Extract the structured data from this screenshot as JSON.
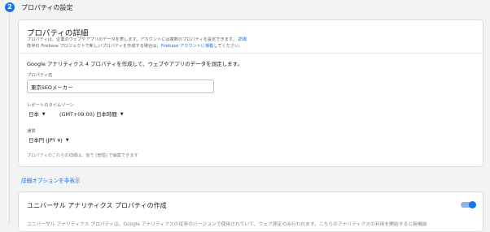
{
  "step": {
    "number": "2",
    "title": "プロパティの設定"
  },
  "details": {
    "title": "プロパティの詳細",
    "desc_line1": "プロパティは、企業のウェブやアプリのデータを表します。アカウントには複数のプロパティを設定できます。",
    "desc_line1_link": "詳細",
    "desc_line2_a": "既存の Firebase プロジェクトで新しいプロパティを作成する場合は、",
    "desc_line2_b": "Firebase アカウントに移動",
    "desc_line2_c": "してください。",
    "instruction": "Google アナリティクス 4 プロパティを作成して、ウェブやアプリのデータを測定します。",
    "name_label": "プロパティ名",
    "name_value": "東京SEOメーカー",
    "timezone_label": "レポートのタイムゾーン",
    "country": "日本",
    "timezone": "(GMT+09:00) 日本時間",
    "currency_label": "通貨",
    "currency": "日本円 (JPY ¥)",
    "hint": "プロパティのこれらの詳細は、後で [管理] で編集できます"
  },
  "advanced_link": "詳細オプションを非表示",
  "universal": {
    "title": "ユニバーサル アナリティクス プロパティの作成",
    "toggle_on": true,
    "desc": "ユニバーサル アナリティクス プロパティは、Google アナリティクスの従来のバージョンで使用されていて、ウェブ測定のみ行われます。こちらのアナリティクスの利用を開始すると新機能"
  },
  "colors": {
    "accent": "#1a73e8",
    "toggle_track": "#8ab4f8"
  }
}
